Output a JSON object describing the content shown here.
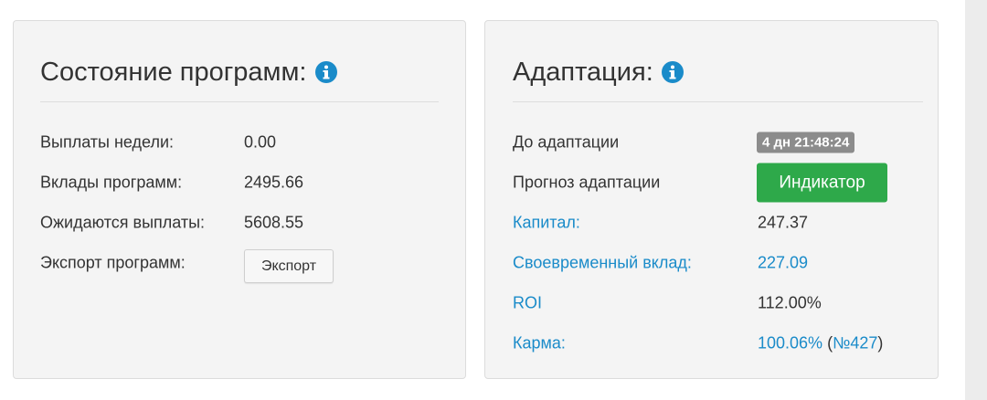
{
  "status_panel": {
    "title": "Состояние программ:",
    "rows": [
      {
        "label": "Выплаты недели:",
        "value": "0.00"
      },
      {
        "label": "Вклады программ:",
        "value": "2495.66"
      },
      {
        "label": "Ожидаются выплаты:",
        "value": "5608.55"
      }
    ],
    "export_label": "Экспорт программ:",
    "export_button": "Экспорт"
  },
  "adaptation_panel": {
    "title": "Адаптация:",
    "until_label": "До адаптации",
    "timer": "4 дн 21:48:24",
    "forecast_label": "Прогноз адаптации",
    "indicator_button": "Индикатор",
    "capital_label": "Капитал:",
    "capital_value": "247.37",
    "timely_label": "Своевременный вклад:",
    "timely_value": "227.09",
    "roi_label": "ROI",
    "roi_value": "112.00%",
    "karma_label": "Карма:",
    "karma_value": "100.06%",
    "karma_open": " (",
    "karma_rank": "№427",
    "karma_close": ")"
  },
  "colors": {
    "link": "#1a8bc9",
    "button_green": "#2ea94a",
    "badge_gray": "#8c8c8c",
    "info_icon": "#1a8bc9"
  },
  "icons": [
    "info-icon",
    "info-icon"
  ]
}
